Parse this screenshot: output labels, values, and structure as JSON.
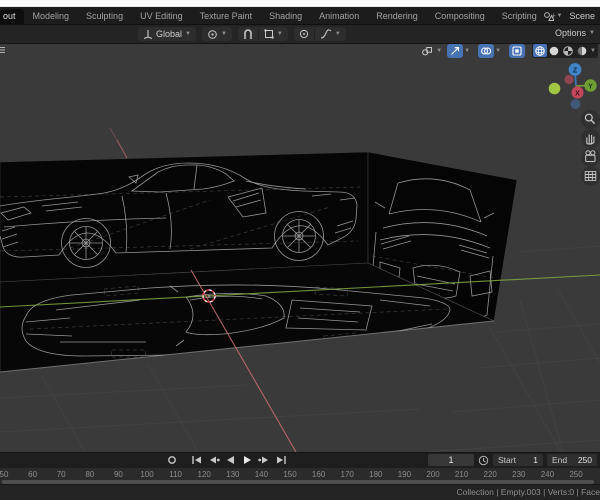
{
  "topbar": {
    "tabs": [
      {
        "label": "out",
        "active": true
      },
      {
        "label": "Modeling"
      },
      {
        "label": "Sculpting"
      },
      {
        "label": "UV Editing"
      },
      {
        "label": "Texture Paint"
      },
      {
        "label": "Shading"
      },
      {
        "label": "Animation"
      },
      {
        "label": "Rendering"
      },
      {
        "label": "Compositing"
      },
      {
        "label": "Scripting"
      },
      {
        "label": "+"
      }
    ],
    "scene_name": "Scene"
  },
  "tool_header": {
    "orientation": "Global",
    "options": "Options"
  },
  "viewport": {
    "gizmo": {
      "x": "X",
      "y": "Y",
      "z": "Z"
    }
  },
  "timeline": {
    "current_frame": "1",
    "start_label": "Start",
    "start_value": "1",
    "end_label": "End",
    "end_value": "250",
    "ruler_labels": [
      "50",
      "60",
      "70",
      "80",
      "90",
      "100",
      "110",
      "120",
      "130",
      "140",
      "150",
      "160",
      "170",
      "180",
      "190",
      "200",
      "210",
      "220",
      "230",
      "240",
      "250"
    ]
  },
  "status_bar": {
    "text": "Collection | Empty.003 | Verts:0 | Face"
  },
  "colors": {
    "accent_active": "#4772b3",
    "axis_x": "#c46a70",
    "axis_y": "#7ea441",
    "axis_z": "#3f8cd3",
    "viewport_bg": "#3a3a3a",
    "plane_bg": "#060606",
    "topbar_bg": "#1c1c1c"
  },
  "icons": [
    "scene-icon",
    "chevron-down-icon",
    "orientation-axes-icon",
    "pivot-point-icon",
    "magnet-snap-icon",
    "snap-target-icon",
    "proportional-edit-icon",
    "falloff-curve-icon",
    "visibility-icon",
    "gizmo-icon",
    "overlays-icon",
    "xray-icon",
    "wireframe-shading-icon",
    "solid-shading-icon",
    "material-shading-icon",
    "rendered-shading-icon",
    "zoom-icon",
    "pan-hand-icon",
    "camera-view-icon",
    "ortho-grid-icon",
    "record-icon",
    "jump-start-icon",
    "prev-keyframe-icon",
    "play-reverse-icon",
    "play-icon",
    "next-keyframe-icon",
    "jump-end-icon",
    "clock-icon",
    "editor-menu-icon",
    "axis-gizmo"
  ]
}
